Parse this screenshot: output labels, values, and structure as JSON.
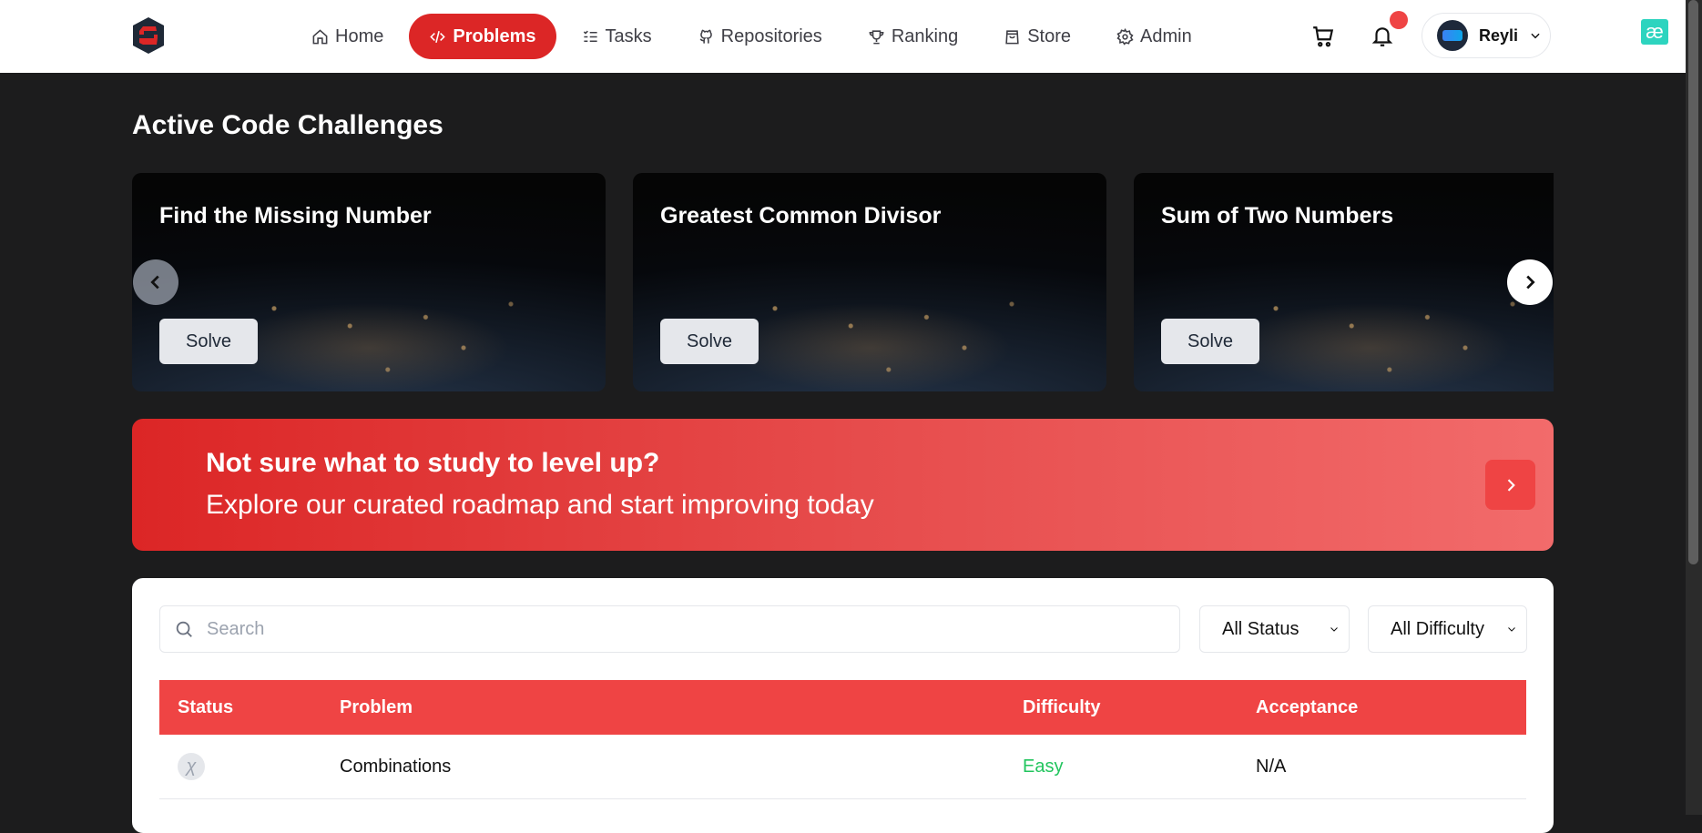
{
  "nav": {
    "items": [
      {
        "label": "Home",
        "icon": "home-icon"
      },
      {
        "label": "Problems",
        "icon": "code-icon",
        "active": true
      },
      {
        "label": "Tasks",
        "icon": "list-checks-icon"
      },
      {
        "label": "Repositories",
        "icon": "github-icon"
      },
      {
        "label": "Ranking",
        "icon": "trophy-icon"
      },
      {
        "label": "Store",
        "icon": "shopping-bag-icon"
      },
      {
        "label": "Admin",
        "icon": "gear-icon"
      }
    ],
    "user_name": "Reyli",
    "has_notification": true,
    "extension_glyph": "æ"
  },
  "challenges": {
    "title": "Active Code Challenges",
    "cards": [
      {
        "title": "Find the Missing Number",
        "button": "Solve"
      },
      {
        "title": "Greatest Common Divisor",
        "button": "Solve"
      },
      {
        "title": "Sum of Two Numbers",
        "button": "Solve"
      }
    ]
  },
  "banner": {
    "title": "Not sure what to study to level up?",
    "subtitle": "Explore our curated roadmap and start improving today"
  },
  "problems": {
    "search_placeholder": "Search",
    "status_filter": "All Status",
    "difficulty_filter": "All Difficulty",
    "columns": [
      "Status",
      "Problem",
      "Difficulty",
      "Acceptance"
    ],
    "rows": [
      {
        "status_glyph": "χ",
        "problem": "Combinations",
        "difficulty": "Easy",
        "acceptance": "N/A"
      }
    ]
  },
  "colors": {
    "accent": "#dc2626",
    "table_header": "#ef4444",
    "easy": "#22c55e",
    "page_bg": "#1c1c1d"
  }
}
